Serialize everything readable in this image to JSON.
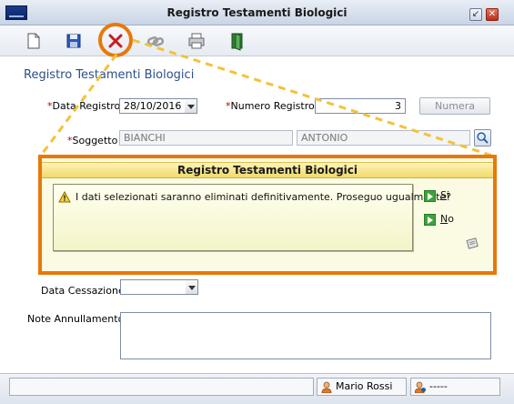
{
  "window": {
    "title": "Registro Testamenti Biologici",
    "min_label": "↙",
    "close_label": "✕"
  },
  "toolbar": {
    "tools": [
      "new-document-icon",
      "save-icon",
      "delete-icon",
      "link-icon",
      "print-icon",
      "exit-icon"
    ],
    "accent": "#e8780a"
  },
  "form": {
    "section_title": "Registro Testamenti Biologici",
    "data_registro_label": "Data Registro",
    "data_registro_value": "28/10/2016",
    "numero_registro_label": "Numero Registro",
    "numero_registro_value": "3",
    "numera_button": "Numera",
    "soggetto_label": "Soggetto",
    "soggetto_cognome": "BIANCHI",
    "soggetto_nome": "ANTONIO",
    "data_cessazione_label": "Data Cessazione",
    "data_cessazione_value": "",
    "note_annullamento_label": "Note Annullamento",
    "note_annullamento_value": "",
    "required_mark": "*"
  },
  "dialog": {
    "title": "Registro Testamenti Biologici",
    "message": "I dati selezionati saranno eliminati definitivamente. Proseguo ugualmente?",
    "yes_first": "S",
    "yes_rest": "i",
    "no_first": "N",
    "no_rest": "o"
  },
  "status": {
    "user": "Mario Rossi",
    "role": "-----"
  }
}
